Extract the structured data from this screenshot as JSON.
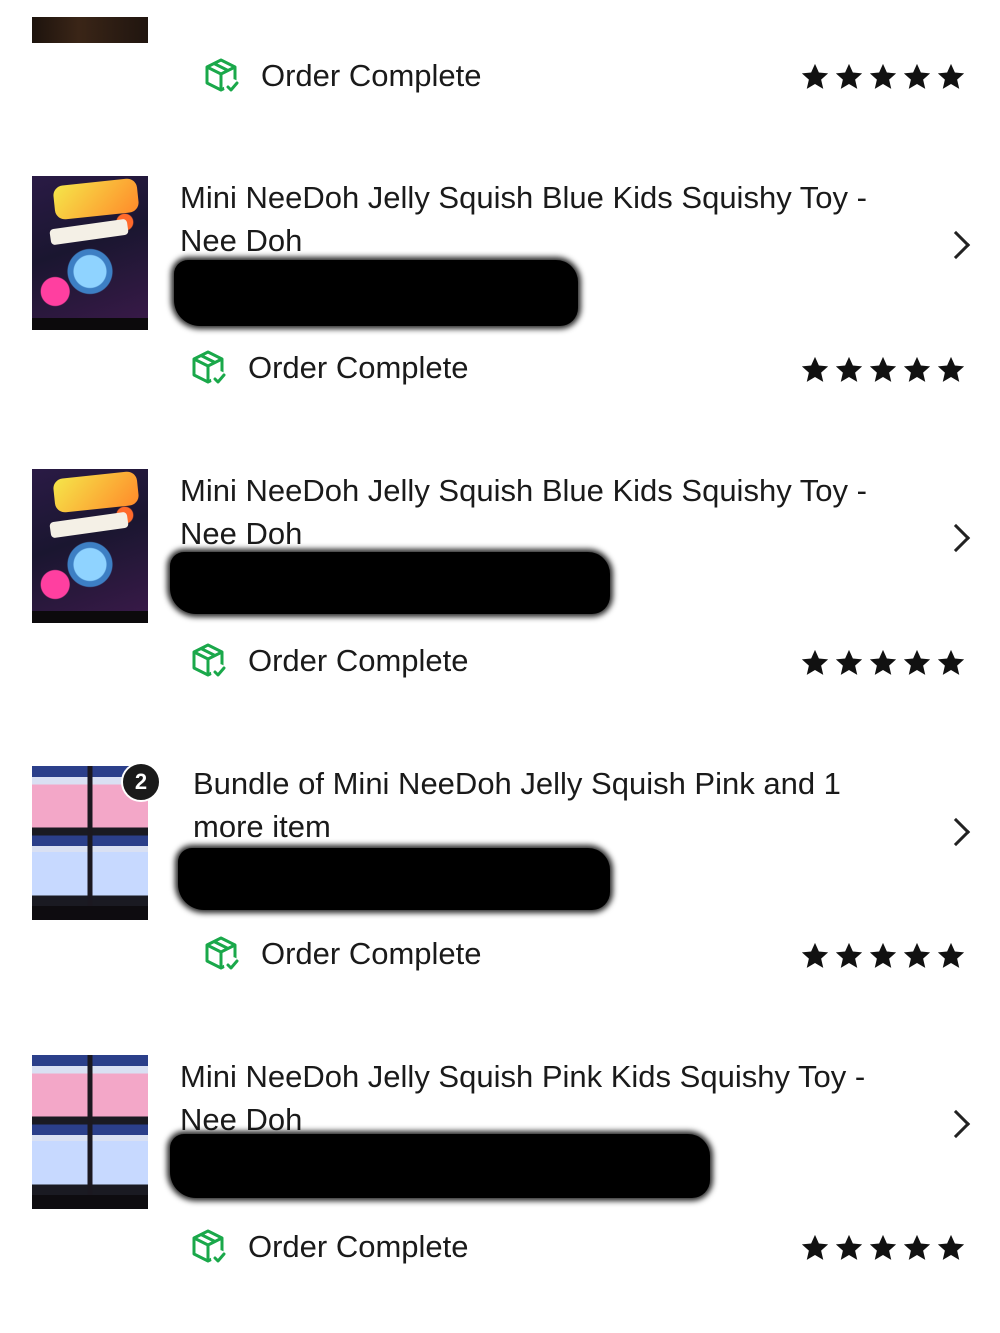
{
  "accent_color": "#1aa84a",
  "status_icon": "package-check-icon",
  "rating_icon": "star-icon",
  "chevron_icon": "chevron-right-icon",
  "orders": [
    {
      "title": "",
      "status": "Order Complete",
      "rating": 5
    },
    {
      "title": "Mini NeeDoh Jelly Squish Blue Kids Squishy Toy - Nee Doh",
      "status": "Order Complete",
      "rating": 5
    },
    {
      "title": "Mini NeeDoh Jelly Squish Blue Kids Squishy Toy - Nee Doh",
      "status": "Order Complete",
      "rating": 5
    },
    {
      "title": "Bundle of Mini NeeDoh Jelly Squish Pink and 1 more item",
      "item_count": "2",
      "status": "Order Complete",
      "rating": 5
    },
    {
      "title": "Mini NeeDoh Jelly Squish Pink Kids Squishy Toy - Nee Doh",
      "status": "Order Complete",
      "rating": 5
    }
  ]
}
